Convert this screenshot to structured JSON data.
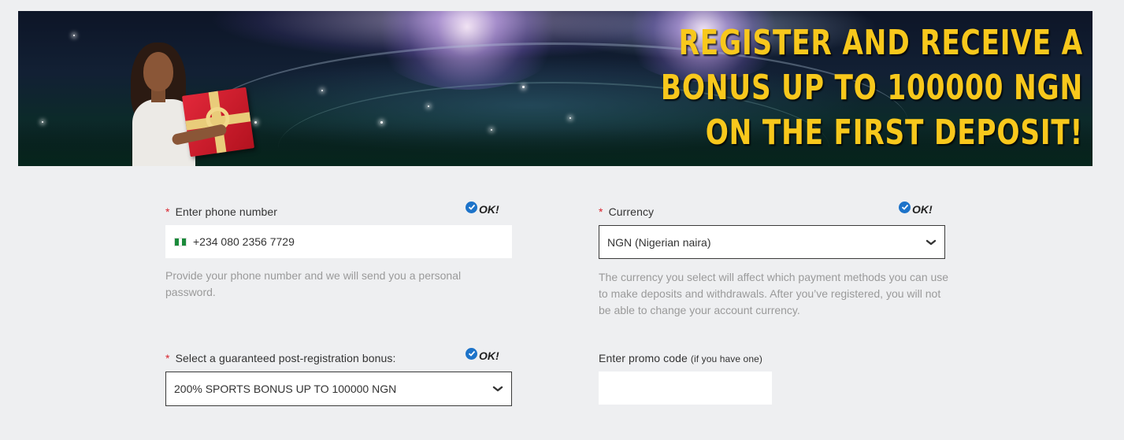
{
  "banner": {
    "title": "REGISTER AND RECEIVE A BONUS UP TO 100000 NGN ON THE FIRST DEPOSIT!"
  },
  "phone": {
    "label": "Enter phone number",
    "required_mark": "*",
    "status": "OK!",
    "value": "+234 080 2356 7729",
    "hint": "Provide your phone number and we will send you a personal password."
  },
  "currency": {
    "label": "Currency",
    "required_mark": "*",
    "status": "OK!",
    "selected": "NGN (Nigerian naira)",
    "hint": "The currency you select will affect which payment methods you can use to make deposits and withdrawals. After you’ve registered, you will not be able to change your account currency."
  },
  "bonus": {
    "label": "Select a guaranteed post-registration bonus:",
    "required_mark": "*",
    "status": "OK!",
    "selected": "200% SPORTS BONUS UP TO 100000 NGN"
  },
  "promo": {
    "label": "Enter promo code",
    "label_note": "(if you have one)",
    "value": ""
  },
  "colors": {
    "accent_yellow": "#f8c81c",
    "required_red": "#d9232d",
    "ok_blue": "#1d73c9",
    "background": "#eeeff1"
  },
  "icons": {
    "ok": "check-circle-icon",
    "dropdown": "chevron-down-icon",
    "flag": "nigeria-flag-icon"
  }
}
